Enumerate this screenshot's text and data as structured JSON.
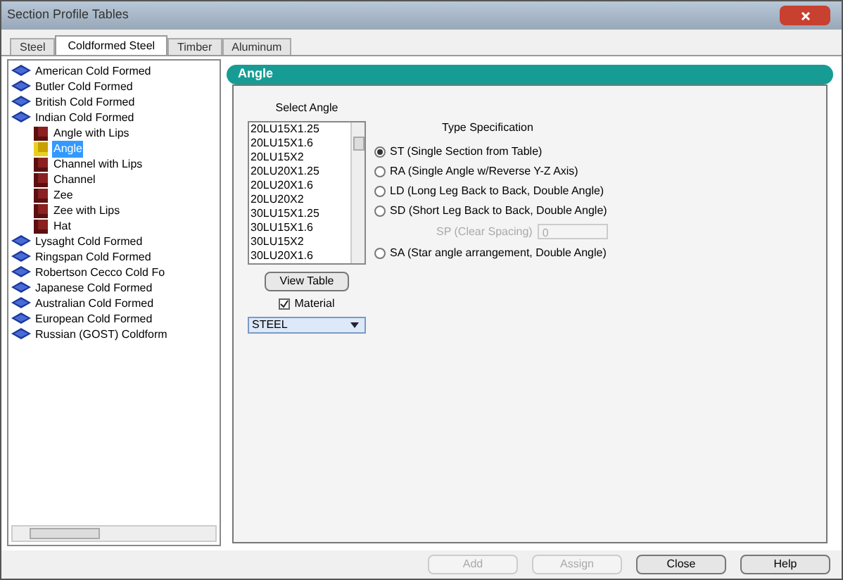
{
  "window": {
    "title": "Section Profile Tables"
  },
  "tabs": [
    {
      "label": "Steel",
      "selected": false
    },
    {
      "label": "Coldformed Steel",
      "selected": true
    },
    {
      "label": "Timber",
      "selected": false
    },
    {
      "label": "Aluminum",
      "selected": false
    }
  ],
  "tree": [
    {
      "label": "American Cold Formed",
      "selected": false
    },
    {
      "label": "Butler Cold Formed",
      "selected": false
    },
    {
      "label": "British Cold Formed",
      "selected": false
    },
    {
      "label": "Indian Cold Formed",
      "selected": false,
      "children": [
        {
          "label": "Angle with Lips",
          "selected": false
        },
        {
          "label": "Angle",
          "selected": true
        },
        {
          "label": "Channel with Lips",
          "selected": false
        },
        {
          "label": "Channel",
          "selected": false
        },
        {
          "label": "Zee",
          "selected": false
        },
        {
          "label": "Zee with Lips",
          "selected": false
        },
        {
          "label": "Hat",
          "selected": false
        }
      ]
    },
    {
      "label": "Lysaght Cold Formed",
      "selected": false
    },
    {
      "label": "Ringspan Cold Formed",
      "selected": false
    },
    {
      "label": "Robertson Cecco Cold Fo",
      "selected": false
    },
    {
      "label": "Japanese Cold Formed",
      "selected": false
    },
    {
      "label": "Australian Cold Formed",
      "selected": false
    },
    {
      "label": "European Cold Formed",
      "selected": false
    },
    {
      "label": "Russian (GOST) Coldform",
      "selected": false
    }
  ],
  "panel": {
    "title": "Angle",
    "list_label": "Select Angle",
    "list": [
      "20LU15X1.25",
      "20LU15X1.6",
      "20LU15X2",
      "20LU20X1.25",
      "20LU20X1.6",
      "20LU20X2",
      "30LU15X1.25",
      "30LU15X1.6",
      "30LU15X2",
      "30LU20X1.6"
    ],
    "view_button": "View Table",
    "material": {
      "label": "Material",
      "checked": true
    },
    "material_value": "STEEL",
    "type_label": "Type Specification",
    "types": [
      {
        "kind": "radio",
        "label": "ST (Single Section from Table)",
        "selected": true
      },
      {
        "kind": "radio",
        "label": "RA (Single Angle w/Reverse Y-Z Axis)",
        "selected": false
      },
      {
        "kind": "radio",
        "label": "LD (Long Leg Back to Back, Double Angle)",
        "selected": false
      },
      {
        "kind": "radio",
        "label": "SD (Short Leg Back to Back, Double Angle)",
        "selected": false
      },
      {
        "kind": "field",
        "label": "SP (Clear Spacing)",
        "value": "0",
        "disabled": true
      },
      {
        "kind": "radio",
        "label": "SA (Star angle arrangement, Double Angle)",
        "selected": false
      }
    ]
  },
  "buttons": [
    {
      "label": "Add",
      "disabled": true
    },
    {
      "label": "Assign",
      "disabled": true
    },
    {
      "label": "Close",
      "disabled": false
    },
    {
      "label": "Help",
      "disabled": false
    }
  ]
}
